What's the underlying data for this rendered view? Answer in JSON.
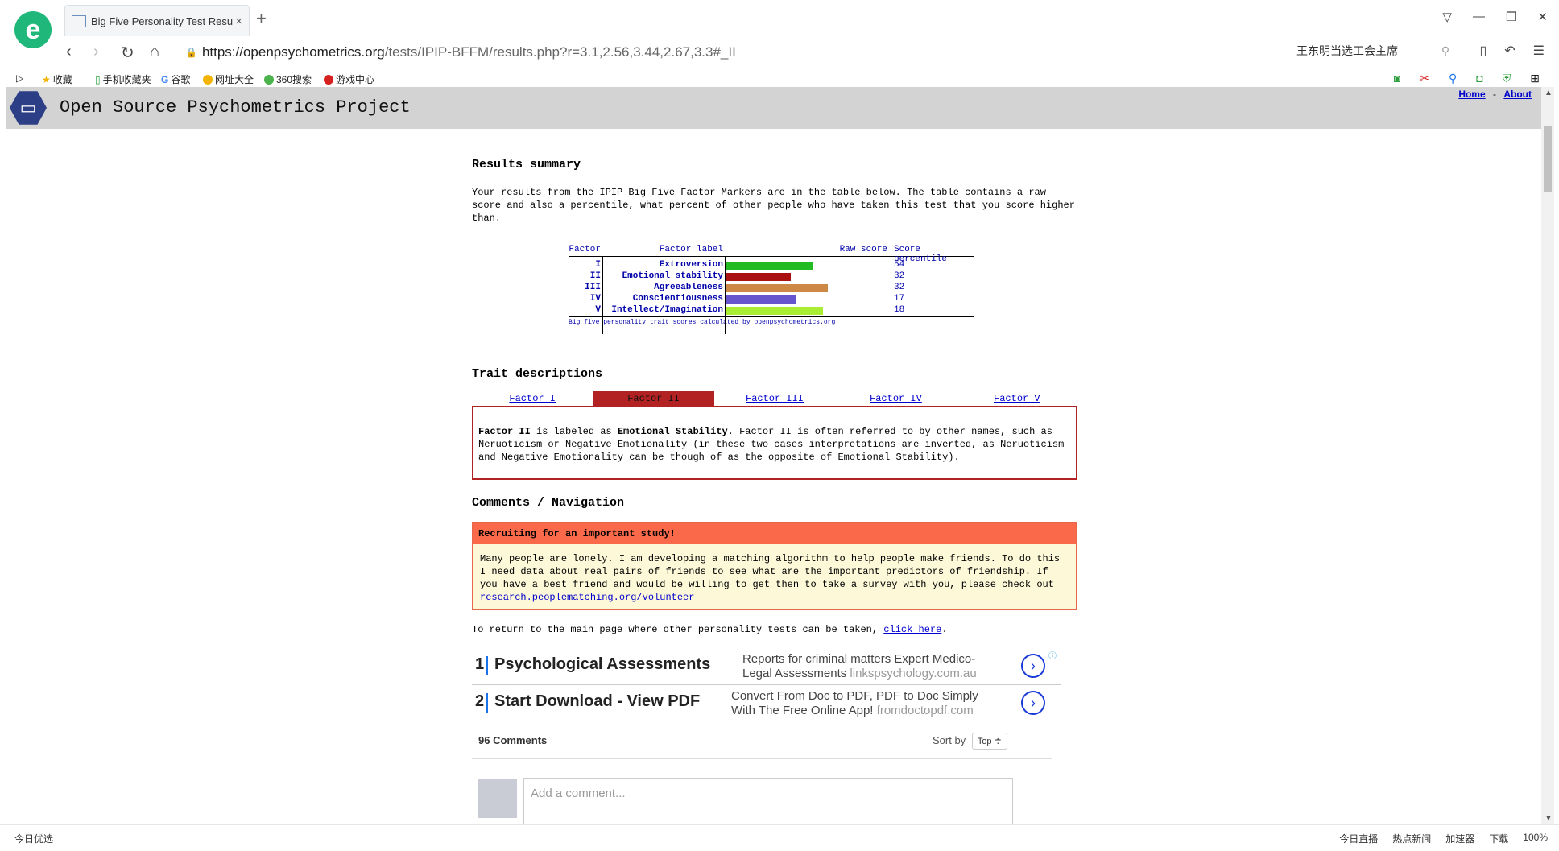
{
  "browser": {
    "tab_title": "Big Five Personality Test Resu",
    "tab_close": "×",
    "new_tab": "+",
    "url_host": "https://openpsychometrics.org",
    "url_path": "/tests/IPIP-BFFM/results.php?r=3.1,2.56,3.44,2.67,3.3#_II",
    "search_text": "王东明当选工会主席",
    "bookmarks": [
      "收藏",
      "手机收藏夹",
      "谷歌",
      "网址大全",
      "360搜索",
      "游戏中心"
    ],
    "status_left": "今日优选",
    "status_right": [
      "今日直播",
      "热点新闻",
      "加速器",
      "下载",
      "100%"
    ]
  },
  "site": {
    "title": "Open Source Psychometrics Project",
    "nav_home": "Home",
    "nav_sep": "-",
    "nav_about": "About"
  },
  "results": {
    "heading": "Results summary",
    "intro": "Your results from the IPIP Big Five Factor Markers are in the table below. The table contains a raw score and also a percentile, what percent of other people who have taken this test that you score higher than.",
    "col_factor": "Factor",
    "col_label": "Factor label",
    "col_raw": "Raw score",
    "col_percentile": "Score percentile",
    "rows": [
      {
        "factor": "I",
        "label": "Extroversion",
        "percentile": 54,
        "bar_fraction": 0.54,
        "color": "#22bb22"
      },
      {
        "factor": "II",
        "label": "Emotional stability",
        "percentile": 32,
        "bar_fraction": 0.4,
        "color": "#aa1111"
      },
      {
        "factor": "III",
        "label": "Agreeableness",
        "percentile": 32,
        "bar_fraction": 0.63,
        "color": "#cc8844"
      },
      {
        "factor": "IV",
        "label": "Conscientiousness",
        "percentile": 17,
        "bar_fraction": 0.43,
        "color": "#6655cc"
      },
      {
        "factor": "V",
        "label": "Intellect/Imagination",
        "percentile": 18,
        "bar_fraction": 0.6,
        "color": "#aaee33"
      }
    ],
    "footer": "Big five personality trait scores calculated by openpsychometrics.org"
  },
  "traits": {
    "heading": "Trait descriptions",
    "tabs": [
      "Factor I",
      "Factor II",
      "Factor III",
      "Factor IV",
      "Factor V"
    ],
    "active_tab": 1,
    "desc_lead": "Factor II",
    "desc_1": " is labeled as ",
    "desc_bold": "Emotional Stability",
    "desc_2": ". Factor II is often referred to by other names, such as Neruoticism or Negative Emotionality (in these two cases interpretations are inverted, as Neruoticism and Negative Emotionality can be though of as the opposite of Emotional Stability)."
  },
  "comments_nav": {
    "heading": "Comments / Navigation",
    "recruit_title": "Recruiting for an important study!",
    "recruit_body": "Many people are lonely. I am developing a matching algorithm to help people make friends. To do this I need data about real pairs of friends to see what are the important predictors of friendship. If you have a best friend and would be willing to get then to take a survey with you, please check out",
    "recruit_link": "research.peoplematching.org/volunteer",
    "return_text": "To return to the main page where other personality tests can be taken,",
    "return_link": "click here",
    "return_end": "."
  },
  "ads": [
    {
      "num": "1",
      "title": "Psychological Assessments",
      "desc": "Reports for criminal matters Expert Medico-Legal Assessments",
      "host": "linkspsychology.com.au"
    },
    {
      "num": "2",
      "title": "Start Download - View PDF",
      "desc": "Convert From Doc to PDF, PDF to Doc Simply With The Free Online App!",
      "host": "fromdoctopdf.com"
    }
  ],
  "comments": {
    "count": "96 Comments",
    "sort_label": "Sort by",
    "sort_value": "Top ≑",
    "placeholder": "Add a comment..."
  }
}
